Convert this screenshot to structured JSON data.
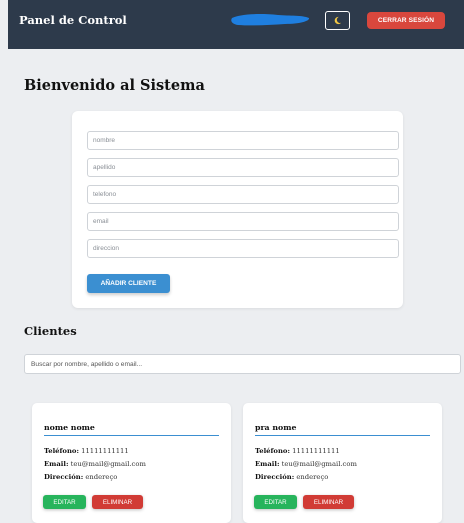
{
  "header": {
    "brand": "Panel de Control",
    "theme_icon": "moon-icon",
    "logout_label": "CERRAR SESIÓN",
    "bg_color": "#2d3a4b",
    "logout_color": "#d9473d"
  },
  "main": {
    "welcome": "Bienvenido al Sistema"
  },
  "form": {
    "fields": [
      {
        "placeholder": "nombre",
        "value": ""
      },
      {
        "placeholder": "apellido",
        "value": ""
      },
      {
        "placeholder": "telefono",
        "value": ""
      },
      {
        "placeholder": "email",
        "value": ""
      },
      {
        "placeholder": "direccion",
        "value": ""
      }
    ],
    "add_label": "AÑADIR CLIENTE",
    "add_color": "#3b8fd1"
  },
  "clients": {
    "title": "Clientes",
    "search_placeholder": "Buscar por nombre, apellido o email...",
    "labels": {
      "phone": "Teléfono:",
      "email": "Email:",
      "address": "Dirección:"
    },
    "edit_label": "EDITAR",
    "delete_label": "ELIMINAR",
    "edit_color": "#27b45c",
    "delete_color": "#d13b35",
    "items": [
      {
        "name": "nome nome",
        "phone": "11111111111",
        "email": "teu@mail@gmail.com",
        "address": "endereço"
      },
      {
        "name": "pra nome",
        "phone": "11111111111",
        "email": "teu@mail@gmail.com",
        "address": "endereço"
      }
    ]
  }
}
